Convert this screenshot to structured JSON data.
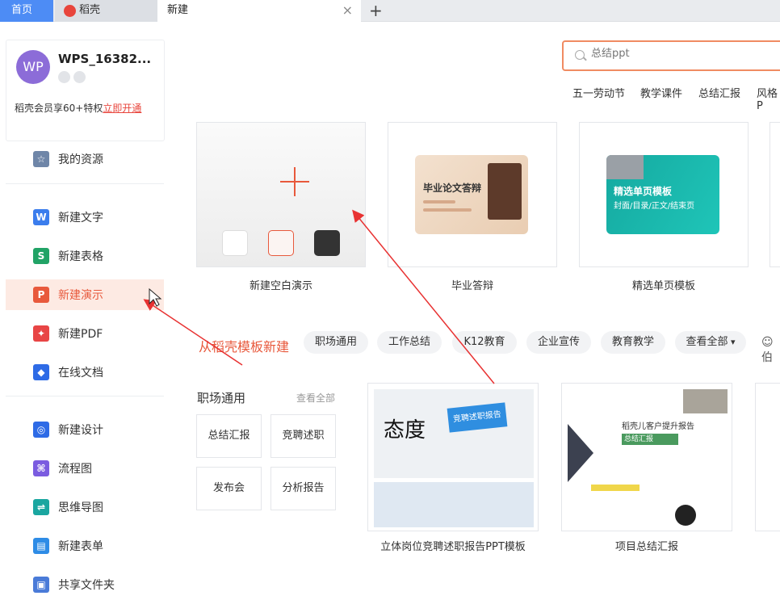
{
  "tabs": {
    "home": "首页",
    "daoke": "稻壳",
    "new": "新建",
    "close_glyph": "×",
    "add_glyph": "+"
  },
  "user": {
    "avatar_text": "WP",
    "name": "WPS_16382...",
    "member_text": "稻壳会员享60+特权",
    "member_link": "立即开通"
  },
  "sidebar": {
    "items": [
      {
        "label": "我的资源",
        "icon": "star-icon",
        "color": "#6f86a8"
      },
      {
        "label": "新建文字",
        "icon": "w-icon",
        "color": "#3b7ded"
      },
      {
        "label": "新建表格",
        "icon": "s-icon",
        "color": "#21a366"
      },
      {
        "label": "新建演示",
        "icon": "p-icon",
        "color": "#e8593c"
      },
      {
        "label": "新建PDF",
        "icon": "pdf-icon",
        "color": "#e84545"
      },
      {
        "label": "在线文档",
        "icon": "cube-icon",
        "color": "#2e6be6"
      },
      {
        "label": "新建设计",
        "icon": "design-icon",
        "color": "#2e6be6"
      },
      {
        "label": "流程图",
        "icon": "flowchart-icon",
        "color": "#7b5ce0"
      },
      {
        "label": "思维导图",
        "icon": "mindmap-icon",
        "color": "#1aa6a0"
      },
      {
        "label": "新建表单",
        "icon": "form-icon",
        "color": "#2e8ce6"
      },
      {
        "label": "共享文件夹",
        "icon": "folder-icon",
        "color": "#4a7bd8"
      }
    ]
  },
  "search": {
    "placeholder": "总结ppt",
    "hot": [
      "五一劳动节",
      "教学课件",
      "总结汇报",
      "风格P"
    ]
  },
  "top_cards": [
    {
      "caption": "新建空白演示"
    },
    {
      "caption": "毕业答辩",
      "thumb_title": "毕业论文答辩"
    },
    {
      "caption": "精选单页模板",
      "thumb_title": "精选单页模板",
      "thumb_sub": "封面/目录/正文/结束页"
    }
  ],
  "section": {
    "title": "从稻壳模板新建",
    "chips": [
      "职场通用",
      "工作总结",
      "K12教育",
      "企业宣传",
      "教育教学",
      "查看全部"
    ],
    "extra": "☺ 伯"
  },
  "category": {
    "title": "职场通用",
    "view_all": "查看全部",
    "buttons": [
      "总结汇报",
      "竞聘述职",
      "发布会",
      "分析报告"
    ]
  },
  "templates": [
    {
      "caption": "立体岗位竞聘述职报告PPT模板",
      "big_char": "态度",
      "banner": "竞聘述职报告"
    },
    {
      "caption": "项目总结汇报",
      "line1": "稻壳儿客户提升报告",
      "line2": "总结汇报"
    }
  ],
  "colors": {
    "accent": "#e8593c",
    "tab_home": "#4d8cf5",
    "active_bg": "#fdeae3"
  }
}
